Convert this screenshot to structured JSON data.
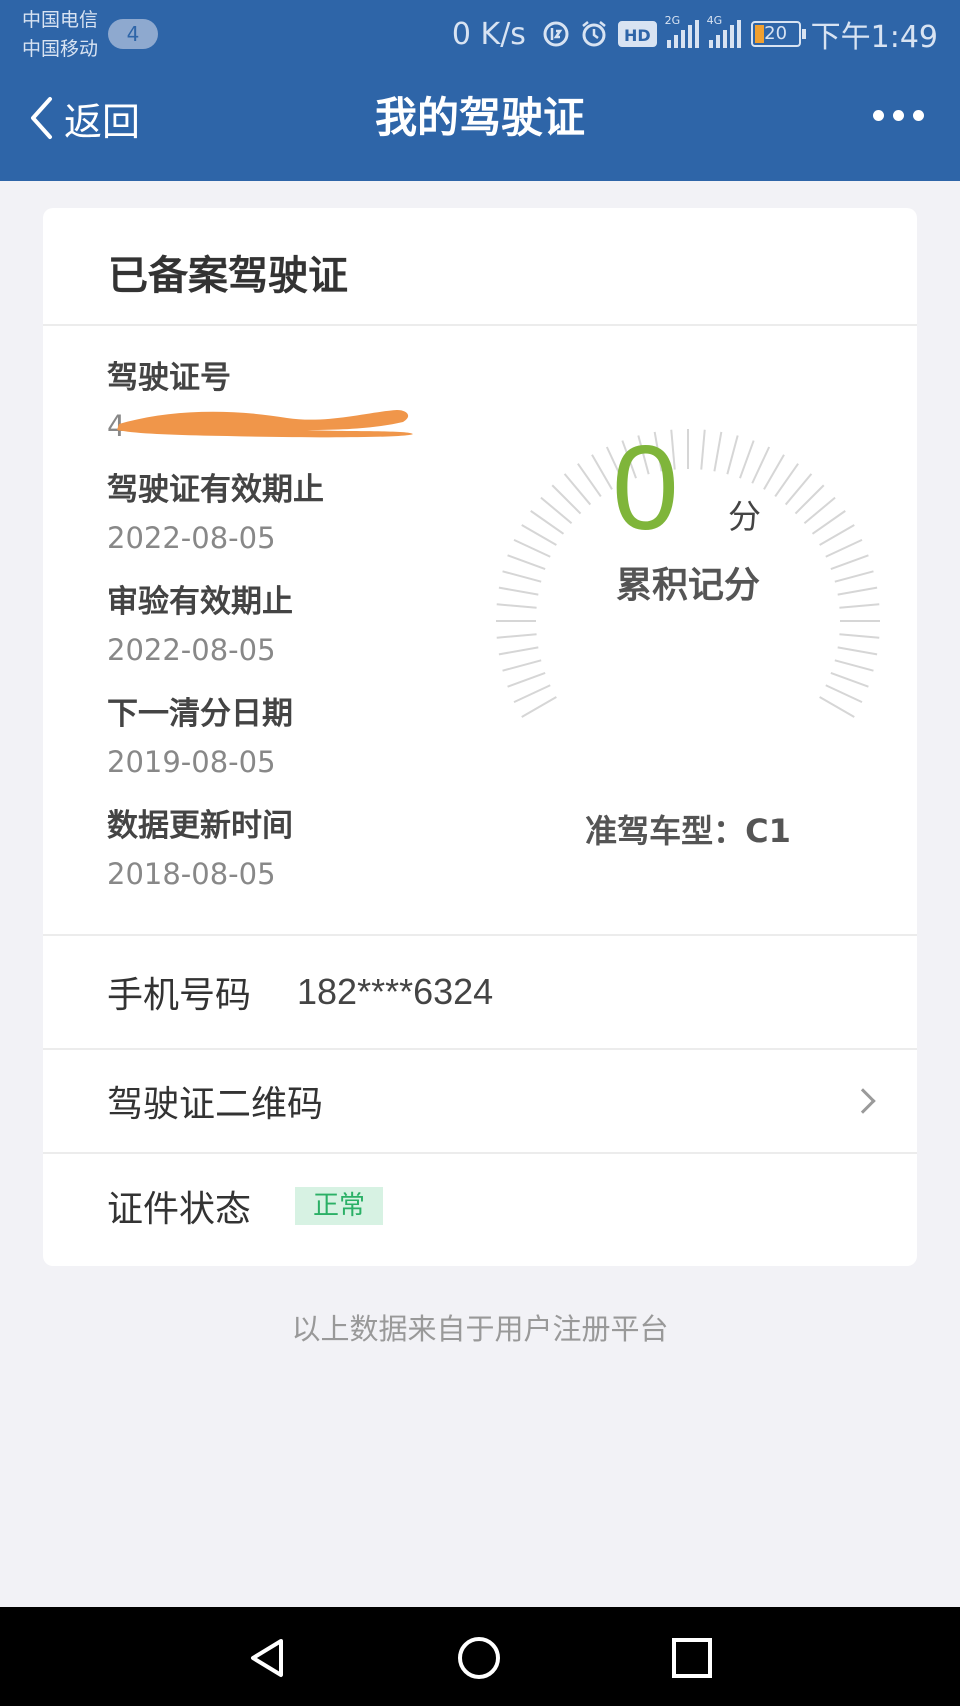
{
  "status_bar": {
    "carrier_1": "中国电信",
    "carrier_2": "中国移动",
    "notification_count": "4",
    "net_speed": "0 K/s",
    "hd_label": "HD",
    "signal_1_tag": "2G",
    "signal_2_tag": "4G",
    "battery_level": "20",
    "time": "下午1:49"
  },
  "nav": {
    "back_label": "返回",
    "title": "我的驾驶证"
  },
  "card": {
    "title": "已备案驾驶证",
    "info": [
      {
        "label": "驾驶证号",
        "value": "4"
      },
      {
        "label": "驾驶证有效期止",
        "value": "2022-08-05"
      },
      {
        "label": "审验有效期止",
        "value": "2022-08-05"
      },
      {
        "label": "下一清分日期",
        "value": "2019-08-05"
      },
      {
        "label": "数据更新时间",
        "value": "2018-08-05"
      }
    ],
    "score": {
      "title": "累积记分",
      "value": "0",
      "unit": "分",
      "value_color": "#7fb53a"
    },
    "license_type": "准驾车型：C1",
    "phone": {
      "label": "手机号码",
      "value": "182****6324"
    },
    "qr_code": {
      "label": "驾驶证二维码"
    },
    "status": {
      "label": "证件状态",
      "value": "正常",
      "color": "#2bb066"
    }
  },
  "footnote": "以上数据来自于用户注册平台",
  "colors": {
    "header_bg": "#2e65a8",
    "page_bg": "#f2f2f6",
    "redaction": "#f0964a"
  },
  "icons": {
    "back": "chevron-left-icon",
    "more": "more-dots-icon",
    "chevron": "chevron-right-icon",
    "nav_back": "triangle-back-icon",
    "nav_home": "circle-home-icon",
    "nav_recent": "square-recent-icon"
  }
}
